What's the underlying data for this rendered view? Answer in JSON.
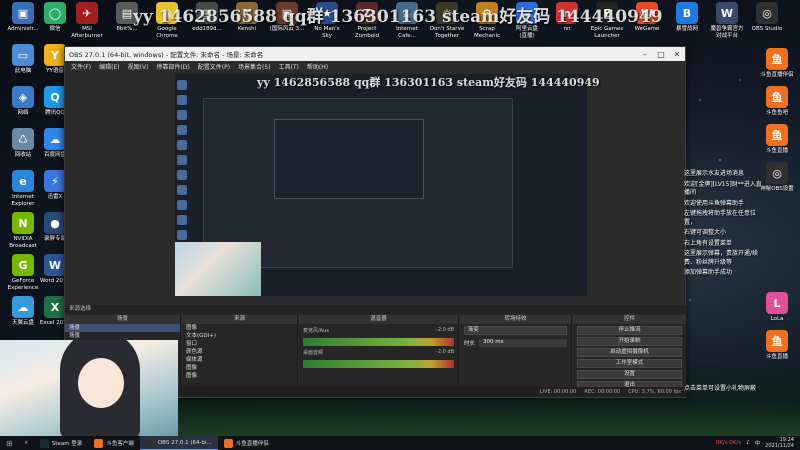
{
  "watermark": "yy 1462856588 qq群 136301163 steam好友码 144440949",
  "watermark_small": "yy 1462856588 qq群 136301163 steam好友码 144440949",
  "desktop_icons_left": [
    {
      "label": "Administr...",
      "color": "#3a6fb5",
      "glyph": "▣"
    },
    {
      "label": "微信",
      "color": "#2aae67",
      "glyph": "◯"
    },
    {
      "label": "此电脑",
      "color": "#4a8cd8",
      "glyph": "▭"
    },
    {
      "label": "YY语音",
      "color": "#f2b01e",
      "glyph": "Y"
    },
    {
      "label": "网络",
      "color": "#3a7ac8",
      "glyph": "◈"
    },
    {
      "label": "腾讯QQ",
      "color": "#1e9be8",
      "glyph": "Q"
    },
    {
      "label": "回收站",
      "color": "#6a8aa8",
      "glyph": "♺"
    },
    {
      "label": "百度网盘",
      "color": "#2e88e8",
      "glyph": "☁"
    },
    {
      "label": "Internet\nExplorer",
      "color": "#2a86d8",
      "glyph": "e"
    },
    {
      "label": "迅雷X",
      "color": "#3a78e0",
      "glyph": "⚡"
    },
    {
      "label": "NVIDIA\nBroadcast",
      "color": "#76b900",
      "glyph": "N"
    },
    {
      "label": "录屏专家",
      "color": "#2a4a7a",
      "glyph": "●"
    },
    {
      "label": "GeForce\nExperience",
      "color": "#76b900",
      "glyph": "G"
    },
    {
      "label": "Word 2010",
      "color": "#2b5797",
      "glyph": "W"
    },
    {
      "label": "天翼云盘",
      "color": "#3a9ae0",
      "glyph": "☁"
    },
    {
      "label": "Excel 2010",
      "color": "#1e7145",
      "glyph": "X"
    }
  ],
  "desktop_icons_top": [
    {
      "label": "MSI\nAfterburner",
      "color": "#a02020",
      "glyph": "✈"
    },
    {
      "label": "8bit%...",
      "color": "#5a5a5a",
      "glyph": "▤"
    },
    {
      "label": "Google\nChrome",
      "color": "#e8c030",
      "glyph": "◉"
    },
    {
      "label": "edd189d...",
      "color": "#4a4a4a",
      "glyph": "▤"
    },
    {
      "label": "Kenshi",
      "color": "#8a6a3a",
      "glyph": "K"
    },
    {
      "label": "(国际风云 3...",
      "color": "#6a3a2a",
      "glyph": "▣"
    },
    {
      "label": "No Man's\nSky",
      "color": "#2a4a8a",
      "glyph": "★"
    },
    {
      "label": "Project\nZomboid",
      "color": "#5a2a2a",
      "glyph": "Z"
    },
    {
      "label": "Internet\nCafe...",
      "color": "#4a6a8a",
      "glyph": "☕"
    },
    {
      "label": "Don't Starve\nTogether",
      "color": "#3a3a2a",
      "glyph": "☼"
    },
    {
      "label": "Scrap\nMechanic",
      "color": "#c08020",
      "glyph": "⚙"
    },
    {
      "label": "阿里云盘\n(直播)",
      "color": "#2a6ae0",
      "glyph": "☁"
    },
    {
      "label": "nn",
      "color": "#d03030",
      "glyph": "n"
    },
    {
      "label": "Epic Games\nLauncher",
      "color": "#222222",
      "glyph": "E"
    },
    {
      "label": "WeGame",
      "color": "#e84a2a",
      "glyph": "W"
    },
    {
      "label": "暴雪战网",
      "color": "#1e7ae0",
      "glyph": "B"
    },
    {
      "label": "魔兽争霸官方\n对战平台",
      "color": "#3a4a6a",
      "glyph": "W"
    },
    {
      "label": "OBS Studio",
      "color": "#303030",
      "glyph": "◎"
    }
  ],
  "desktop_icons_right": [
    {
      "label": "斗鱼直播伴侣",
      "color": "#f07020",
      "glyph": "鱼"
    },
    {
      "label": "斗鱼鱼吧",
      "color": "#f07020",
      "glyph": "鱼"
    },
    {
      "label": "斗鱼直播",
      "color": "#f07020",
      "glyph": "鱼"
    },
    {
      "label": "神秘OBS设置",
      "color": "#303030",
      "glyph": "◎"
    },
    {
      "label": "LoLa",
      "color": "#e0509a",
      "glyph": "L"
    },
    {
      "label": "斗鱼直播",
      "color": "#f07020",
      "glyph": "鱼"
    }
  ],
  "obs": {
    "title": "OBS 27.0.1 (64-bit, windows) - 配置文件: 未命名 - 场景: 未命名",
    "menu": [
      "文件(F)",
      "编辑(E)",
      "视图(V)",
      "停靠部件(D)",
      "配置文件(P)",
      "场景集合(S)",
      "工具(T)",
      "帮助(H)"
    ],
    "dock_header": "来源选择",
    "panels": {
      "scenes": {
        "title": "场景",
        "items": [
          "场景",
          "场景"
        ]
      },
      "sources": {
        "title": "来源",
        "items": [
          "图像",
          "文本(GDI+)",
          "窗口",
          "颜色源",
          "媒体源",
          "图像",
          "图像"
        ]
      },
      "mixer": {
        "title": "混音器",
        "tracks": [
          {
            "name": "麦克风/Aux",
            "db": "-2.0 dB"
          },
          {
            "name": "桌面音频",
            "db": "-2.0 dB"
          }
        ]
      },
      "transitions": {
        "title": "转场特效",
        "fade": "渐变",
        "duration_label": "时长",
        "duration": "300 ms"
      },
      "controls": {
        "title": "控件",
        "buttons": [
          "停止推流",
          "开始录制",
          "启动虚拟摄像机",
          "工作室模式",
          "设置",
          "退出"
        ]
      }
    },
    "status": [
      "LIVE: 00:00:00",
      "REC: 00:00:00",
      "CPU: 3.7%, 60.00 fps"
    ]
  },
  "chat": [
    "这里展示水友进场消息",
    "欢迎[金牌][LV15]财**进入直播间",
    "欢迎使用斗鱼弹幕助手",
    "左键拖拽将助手放在任意位置，",
    "右键可调整大小",
    "右上角有设置菜单",
    "这里展示弹幕，贵族开通/续费、粉丝牌升级等",
    "添加弹幕助手成功"
  ],
  "chat_bottom": "点击菜单可设置小礼物屏蔽",
  "taskbar": {
    "items": [
      {
        "label": "Steam 登录",
        "color": "#1b2838"
      },
      {
        "label": "斗鱼客户端",
        "color": "#f07020"
      },
      {
        "label": "OBS 27.0.1 (64-bi...",
        "color": "#303030",
        "active": true
      },
      {
        "label": "斗鱼直播伴侣",
        "color": "#f07020"
      }
    ],
    "net": "0K/s 0K/s",
    "time": "19:24",
    "date": "2021/11/24"
  }
}
